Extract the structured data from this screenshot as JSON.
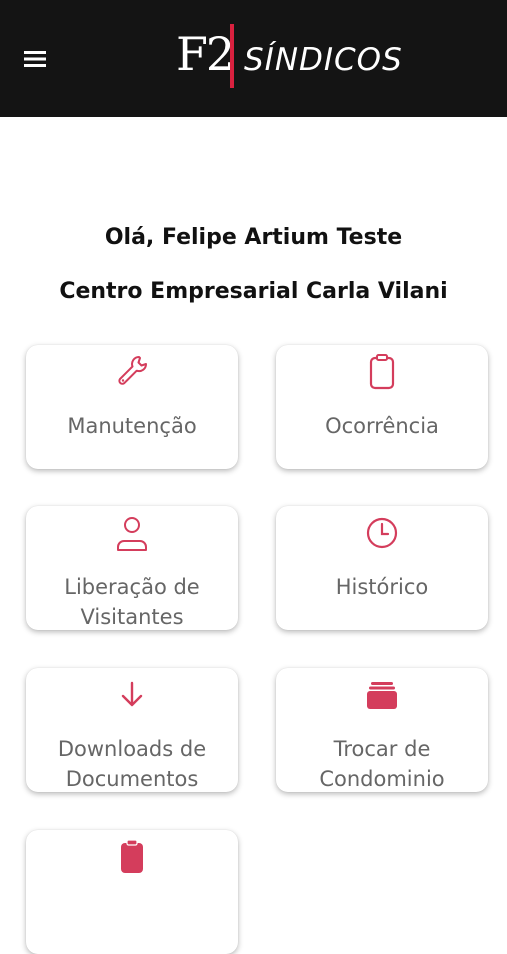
{
  "header": {
    "logo_mark": "F2",
    "logo_text": "SÍNDICOS"
  },
  "welcome": {
    "greeting": "Olá, Felipe Artium Teste",
    "condominium": "Centro Empresarial Carla Vilani"
  },
  "menu_cards": [
    {
      "line1": "Manutenção",
      "line2": "",
      "icon": "wrench-icon"
    },
    {
      "line1": "Ocorrência",
      "line2": "",
      "icon": "clipboard-icon"
    },
    {
      "line1": "Liberação de",
      "line2": "Visitantes",
      "icon": "person-icon"
    },
    {
      "line1": "Histórico",
      "line2": "",
      "icon": "clock-icon"
    },
    {
      "line1": "Downloads de",
      "line2": "Documentos",
      "icon": "arrow-down-icon"
    },
    {
      "line1": "Trocar de",
      "line2": "Condominio",
      "icon": "stack-icon"
    },
    {
      "line1": "",
      "line2": "",
      "icon": "clipboard-filled-icon"
    }
  ],
  "colors": {
    "accent": "#d43d5c",
    "topbar": "#141414",
    "logo_bar": "#d9213f",
    "card_label": "#666666"
  }
}
